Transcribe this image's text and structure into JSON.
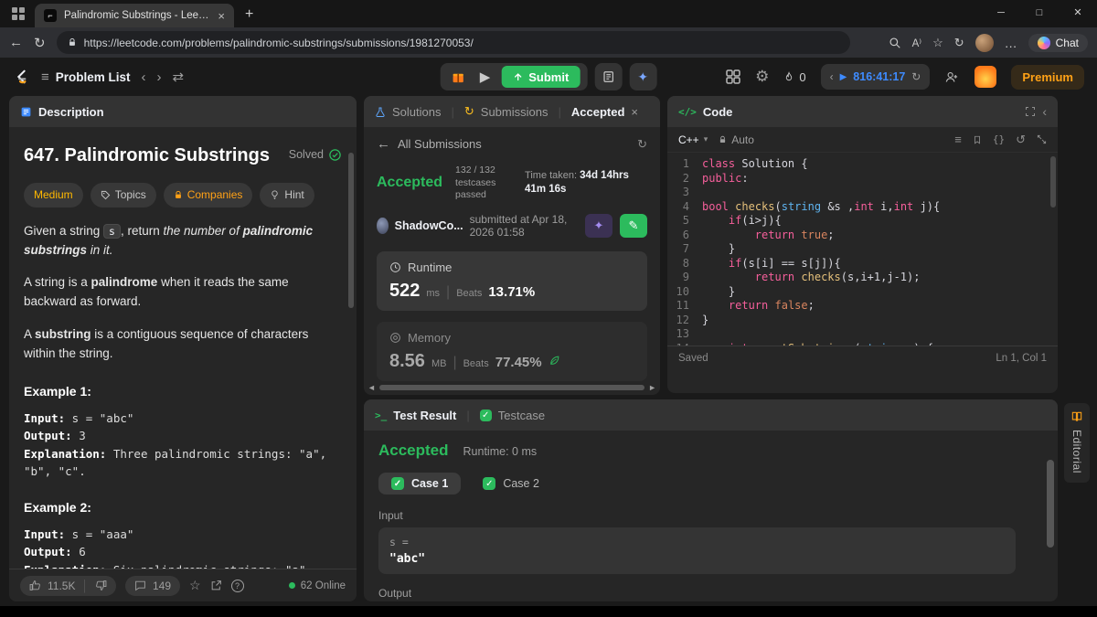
{
  "colors": {
    "accent_green": "#2cbb5d",
    "accent_orange": "#ffa116",
    "medium_yellow": "#ffb800",
    "timer_blue": "#3e8bff"
  },
  "browser": {
    "tab_title": "Palindromic Substrings - LeetCode",
    "url": "https://leetcode.com/problems/palindromic-substrings/submissions/1981270053/",
    "read_aloud_glyph": "A⁾",
    "chat_label": "Chat"
  },
  "header": {
    "problem_list_label": "Problem List",
    "submit_label": "Submit",
    "streak_count": "0",
    "timer_value": "816:41:17",
    "premium_label": "Premium"
  },
  "description": {
    "tab_label": "Description",
    "title": "647. Palindromic Substrings",
    "solved_label": "Solved",
    "badges": {
      "difficulty": "Medium",
      "topics": "Topics",
      "companies": "Companies",
      "hint": "Hint"
    },
    "p1": {
      "t1": "Given a string ",
      "code": "s",
      "t2": ", return ",
      "t3": "the number of ",
      "t4": "palindromic substrings",
      "t5": " in it."
    },
    "p2": {
      "t1": "A string is a ",
      "t2": "palindrome",
      "t3": " when it reads the same backward as forward."
    },
    "p3": {
      "t1": "A ",
      "t2": "substring",
      "t3": " is a contiguous sequence of characters within the string."
    },
    "example1": {
      "label": "Example 1:",
      "input_label": "Input:",
      "input_value": " s = \"abc\"",
      "output_label": "Output:",
      "output_value": " 3",
      "expl_label": "Explanation:",
      "expl_value": " Three palindromic strings: \"a\", \"b\", \"c\"."
    },
    "example2": {
      "label": "Example 2:",
      "input_label": "Input:",
      "input_value": " s = \"aaa\"",
      "output_label": "Output:",
      "output_value": " 6",
      "expl_label": "Explanation:",
      "expl_value": " Six palindromic strings: \"a\", \"a\", \"a\", \"aa\", \"aa\", \"aaa\"."
    },
    "footer": {
      "likes": "11.5K",
      "comments": "149",
      "online": "62 Online"
    }
  },
  "submissions": {
    "tab_solutions": "Solutions",
    "tab_submissions": "Submissions",
    "tab_accepted": "Accepted",
    "back_label": "All Submissions",
    "status": "Accepted",
    "testcases": "132 / 132 testcases passed",
    "time_label": "Time taken:",
    "time_value": "34d 14hrs 41m 16s",
    "user": "ShadowCo...",
    "submitted": "submitted at Apr 18, 2026 01:58",
    "runtime": {
      "label": "Runtime",
      "value": "522",
      "unit": "ms",
      "beats_label": "Beats",
      "beats": "13.71%"
    },
    "memory": {
      "label": "Memory",
      "value": "8.56",
      "unit": "MB",
      "beats_label": "Beats",
      "beats": "77.45%"
    }
  },
  "code": {
    "tab_label": "Code",
    "icon_glyph": "</>",
    "language": "C++",
    "auto_label": "Auto",
    "saved_label": "Saved",
    "cursor_position": "Ln 1, Col 1",
    "lines": [
      [
        [
          "k",
          "class"
        ],
        [
          "p",
          " Solution {"
        ]
      ],
      [
        [
          "k",
          "public"
        ],
        [
          "p",
          ":"
        ]
      ],
      [],
      [
        [
          "k",
          "bool"
        ],
        [
          "p",
          " "
        ],
        [
          "f",
          "checks"
        ],
        [
          "p",
          "("
        ],
        [
          "t",
          "string"
        ],
        [
          "p",
          " &s ,"
        ],
        [
          "k",
          "int"
        ],
        [
          "p",
          " i,"
        ],
        [
          "k",
          "int"
        ],
        [
          "p",
          " j){"
        ]
      ],
      [
        [
          "p",
          "    "
        ],
        [
          "k",
          "if"
        ],
        [
          "p",
          "(i>j){"
        ]
      ],
      [
        [
          "p",
          "        "
        ],
        [
          "k",
          "return"
        ],
        [
          "p",
          " "
        ],
        [
          "b",
          "true"
        ],
        [
          "p",
          ";"
        ]
      ],
      [
        [
          "p",
          "    }"
        ]
      ],
      [
        [
          "p",
          "    "
        ],
        [
          "k",
          "if"
        ],
        [
          "p",
          "(s[i] == s[j]){"
        ]
      ],
      [
        [
          "p",
          "        "
        ],
        [
          "k",
          "return"
        ],
        [
          "p",
          " "
        ],
        [
          "f",
          "checks"
        ],
        [
          "p",
          "(s,i+1,j-1);"
        ]
      ],
      [
        [
          "p",
          "    }"
        ]
      ],
      [
        [
          "p",
          "    "
        ],
        [
          "k",
          "return"
        ],
        [
          "p",
          " "
        ],
        [
          "b",
          "false"
        ],
        [
          "p",
          ";"
        ]
      ],
      [
        [
          "p",
          "}"
        ]
      ],
      [],
      [
        [
          "p",
          "    "
        ],
        [
          "k",
          "int"
        ],
        [
          "p",
          " "
        ],
        [
          "f",
          "countSubstrings"
        ],
        [
          "p",
          "("
        ],
        [
          "t",
          "string"
        ],
        [
          "p",
          " s) {"
        ]
      ]
    ]
  },
  "test": {
    "tab_result": "Test Result",
    "tab_testcase": "Testcase",
    "terminal_glyph": ">_",
    "status": "Accepted",
    "runtime": "Runtime: 0 ms",
    "cases": [
      "Case 1",
      "Case 2"
    ],
    "input_label": "Input",
    "input_var": "s =",
    "input_value": "\"abc\"",
    "output_label": "Output"
  },
  "editorial_label": "Editorial"
}
